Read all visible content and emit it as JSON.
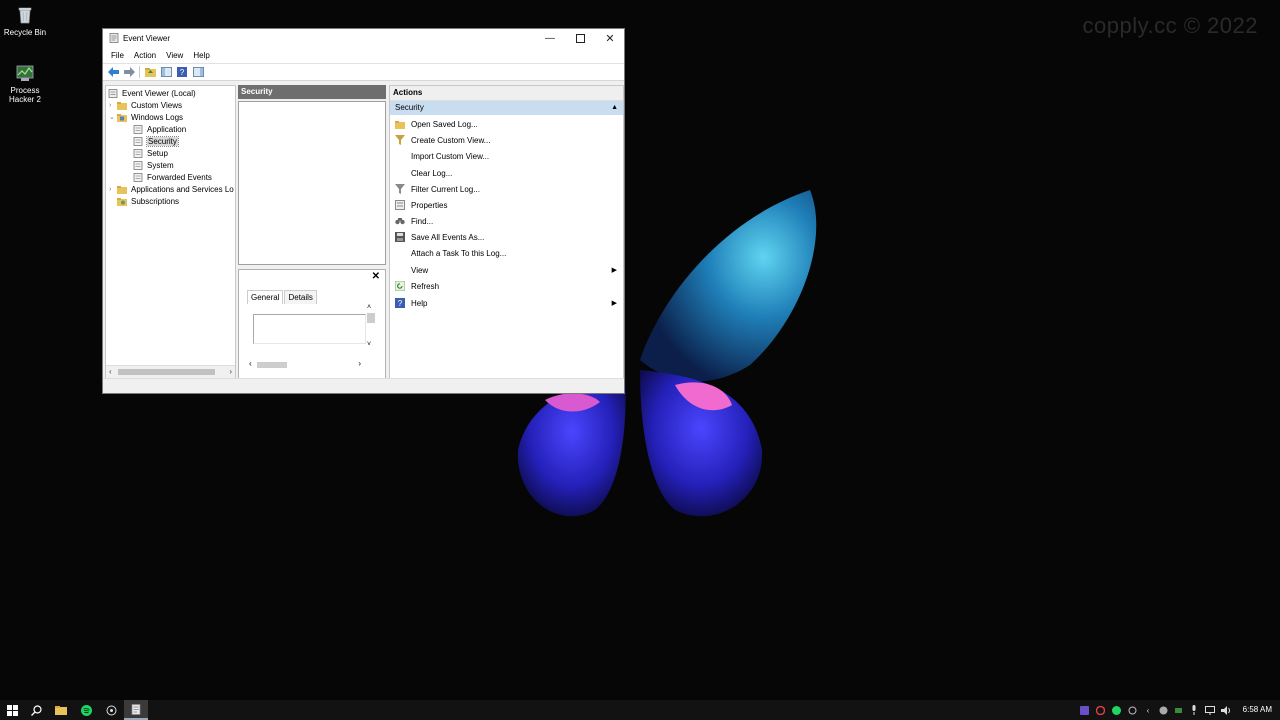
{
  "desktop": {
    "watermark": "copply.cc © 2022",
    "icons": [
      {
        "label": "Recycle Bin",
        "icon": "recycle-bin-icon"
      },
      {
        "label": "Process Hacker 2",
        "icon": "process-hacker-icon"
      }
    ]
  },
  "window": {
    "title": "Event Viewer",
    "menu": [
      "File",
      "Action",
      "View",
      "Help"
    ],
    "toolbar": [
      "back-icon",
      "forward-icon",
      "up-folder-icon",
      "show-hide-console-tree-icon",
      "help-icon",
      "show-hide-action-pane-icon"
    ],
    "tree": {
      "root": "Event Viewer (Local)",
      "custom_views": "Custom Views",
      "windows_logs": "Windows Logs",
      "logs": [
        "Application",
        "Security",
        "Setup",
        "System",
        "Forwarded Events"
      ],
      "app_services": "Applications and Services Lo",
      "subscriptions": "Subscriptions",
      "selected": "Security"
    },
    "middle": {
      "header": "Security",
      "tabs": [
        "General",
        "Details"
      ]
    },
    "actions": {
      "header": "Actions",
      "section": "Security",
      "items": [
        {
          "label": "Open Saved Log...",
          "icon": "open-log-icon"
        },
        {
          "label": "Create Custom View...",
          "icon": "filter-create-icon"
        },
        {
          "label": "Import Custom View...",
          "icon": ""
        },
        {
          "label": "Clear Log...",
          "icon": ""
        },
        {
          "label": "Filter Current Log...",
          "icon": "filter-icon"
        },
        {
          "label": "Properties",
          "icon": "properties-icon"
        },
        {
          "label": "Find...",
          "icon": "find-icon"
        },
        {
          "label": "Save All Events As...",
          "icon": "save-icon"
        },
        {
          "label": "Attach a Task To this Log...",
          "icon": ""
        },
        {
          "label": "View",
          "icon": "",
          "submenu": true
        },
        {
          "label": "Refresh",
          "icon": "refresh-icon"
        },
        {
          "label": "Help",
          "icon": "help-icon",
          "submenu": true
        }
      ]
    }
  },
  "taskbar": {
    "clock": "6:58 AM"
  },
  "colors": {
    "desktop": "#060606",
    "selection": "#c9ddf1",
    "middle_header": "#6e6e6e"
  }
}
